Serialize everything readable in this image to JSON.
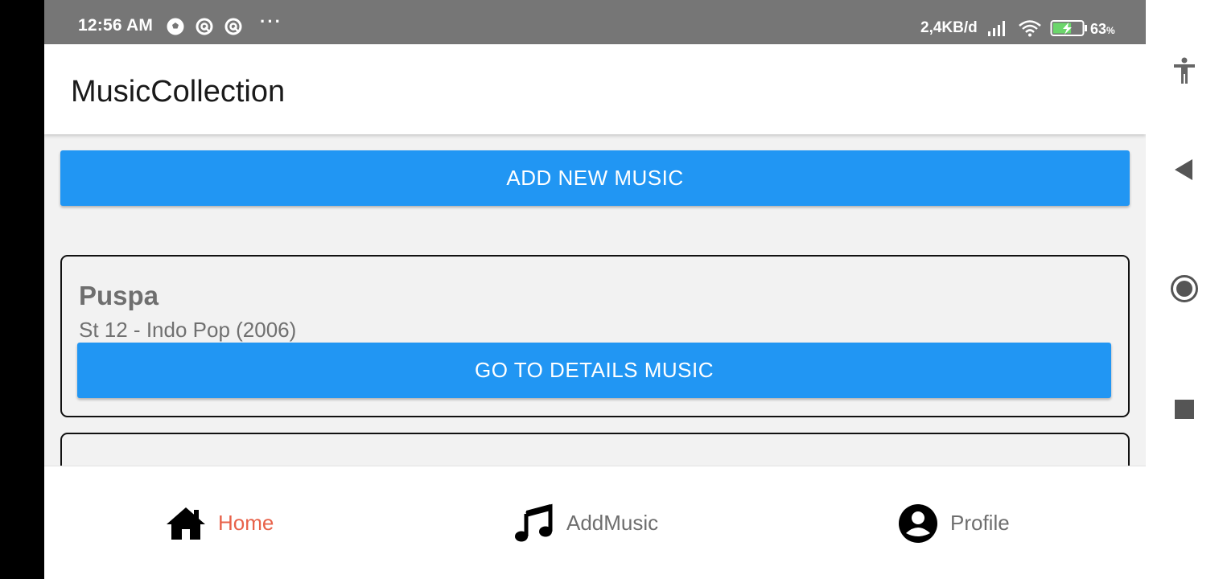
{
  "status_bar": {
    "time": "12:56 AM",
    "left_icons": [
      "soccer-ball-icon",
      "notification-icon",
      "notification-icon"
    ],
    "overflow": "···",
    "network_speed": "2,4KB/d",
    "battery_percent": "63",
    "battery_unit": "%",
    "battery_level": 0.63
  },
  "appbar": {
    "title": "MusicCollection"
  },
  "main": {
    "add_button_label": "ADD NEW MUSIC",
    "cards": [
      {
        "title": "Puspa",
        "subtitle": "St 12 - Indo Pop (2006)",
        "button_label": "GO TO DETAILS MUSIC"
      }
    ]
  },
  "bottom_nav": {
    "items": [
      {
        "label": "Home",
        "icon": "home-icon",
        "active": true
      },
      {
        "label": "AddMusic",
        "icon": "music-note-icon",
        "active": false
      },
      {
        "label": "Profile",
        "icon": "account-circle-icon",
        "active": false
      }
    ],
    "active_color": "#e8624a",
    "inactive_color": "#6e6e6e"
  },
  "system_nav": {
    "buttons": [
      "accessibility-icon",
      "back-icon",
      "home-circle-icon",
      "recents-square-icon"
    ]
  },
  "colors": {
    "primary": "#2196f3",
    "status_bar": "#767676",
    "background": "#f2f2f2"
  }
}
